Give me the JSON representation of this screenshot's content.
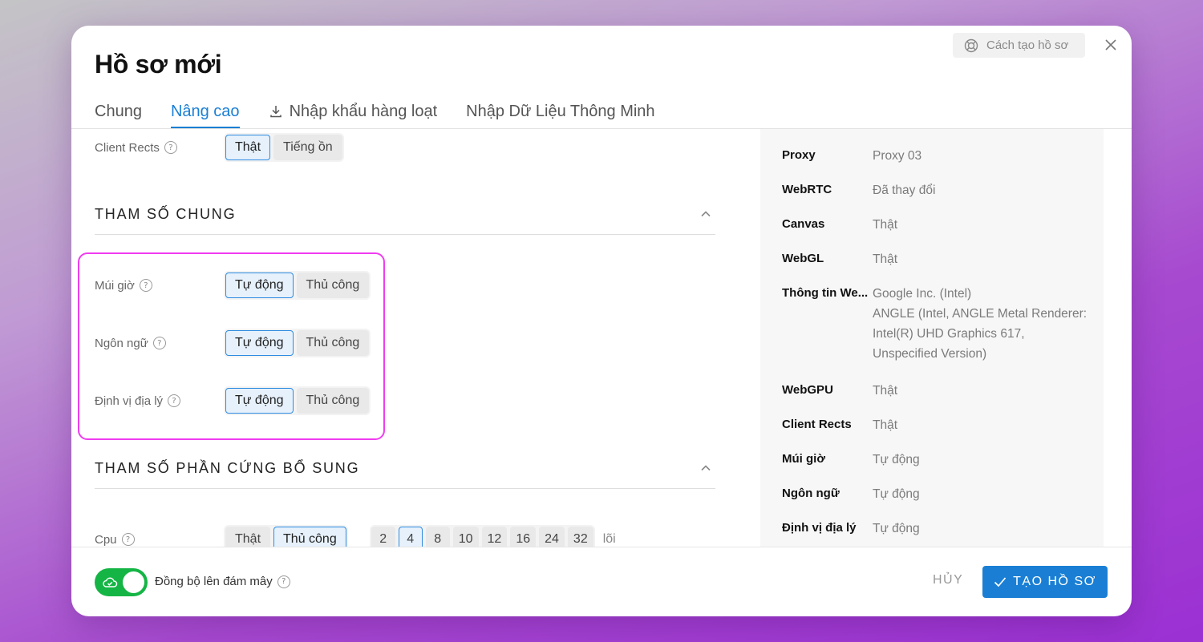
{
  "dialog": {
    "title": "Hồ sơ mới",
    "help_label": "Cách tạo hồ sơ",
    "tabs": [
      {
        "label": "Chung"
      },
      {
        "label": "Nâng cao"
      },
      {
        "label": "Nhập khẩu hàng loạt"
      },
      {
        "label": "Nhập Dữ Liệu Thông Minh"
      }
    ],
    "active_tab": "Nâng cao"
  },
  "client_rects": {
    "label": "Client Rects",
    "options": [
      "Thật",
      "Tiếng ồn"
    ],
    "selected": "Thật"
  },
  "general_section": {
    "title": "THAM SỐ CHUNG",
    "rows": [
      {
        "label": "Múi giờ",
        "options": [
          "Tự động",
          "Thủ công"
        ],
        "selected": "Tự động"
      },
      {
        "label": "Ngôn ngữ",
        "options": [
          "Tự động",
          "Thủ công"
        ],
        "selected": "Tự động"
      },
      {
        "label": "Định vị địa lý",
        "options": [
          "Tự động",
          "Thủ công"
        ],
        "selected": "Tự động"
      }
    ]
  },
  "hardware_section": {
    "title": "THAM SỐ PHẦN CỨNG BỔ SUNG",
    "cpu": {
      "label": "Cpu",
      "modes": [
        "Thật",
        "Thủ công"
      ],
      "selected_mode": "Thủ công",
      "cores": [
        "2",
        "4",
        "8",
        "10",
        "12",
        "16",
        "24",
        "32"
      ],
      "selected_core": "4",
      "unit": "lõi"
    }
  },
  "summary": [
    {
      "key": "Proxy",
      "value": "Proxy 03"
    },
    {
      "key": "WebRTC",
      "value": "Đã thay đổi"
    },
    {
      "key": "Canvas",
      "value": "Thật"
    },
    {
      "key": "WebGL",
      "value": "Thật"
    },
    {
      "key": "Thông tin WebGL",
      "key_display": "Thông tin We...",
      "value": "Google Inc. (Intel)",
      "value_extra": "ANGLE (Intel, ANGLE Metal Renderer: Intel(R) UHD Graphics 617, Unspecified Version)"
    },
    {
      "key": "WebGPU",
      "value": "Thật"
    },
    {
      "key": "Client Rects",
      "value": "Thật"
    },
    {
      "key": "Múi giờ",
      "value": "Tự động"
    },
    {
      "key": "Ngôn ngữ",
      "value": "Tự động"
    },
    {
      "key": "Định vị địa lý",
      "value": "Tự động"
    }
  ],
  "footer": {
    "sync_label": "Đồng bộ lên đám mây",
    "sync_on": true,
    "cancel_label": "HỦY",
    "create_label": "TẠO HỒ SƠ"
  },
  "colors": {
    "accent": "#1a7fd4",
    "toggle": "#15b545",
    "highlight": "#f03cf0"
  },
  "icons": [
    "lifebuoy-icon",
    "close-icon",
    "download-icon",
    "help-icon",
    "chevron-up-icon",
    "cloud-icon",
    "check-icon"
  ]
}
